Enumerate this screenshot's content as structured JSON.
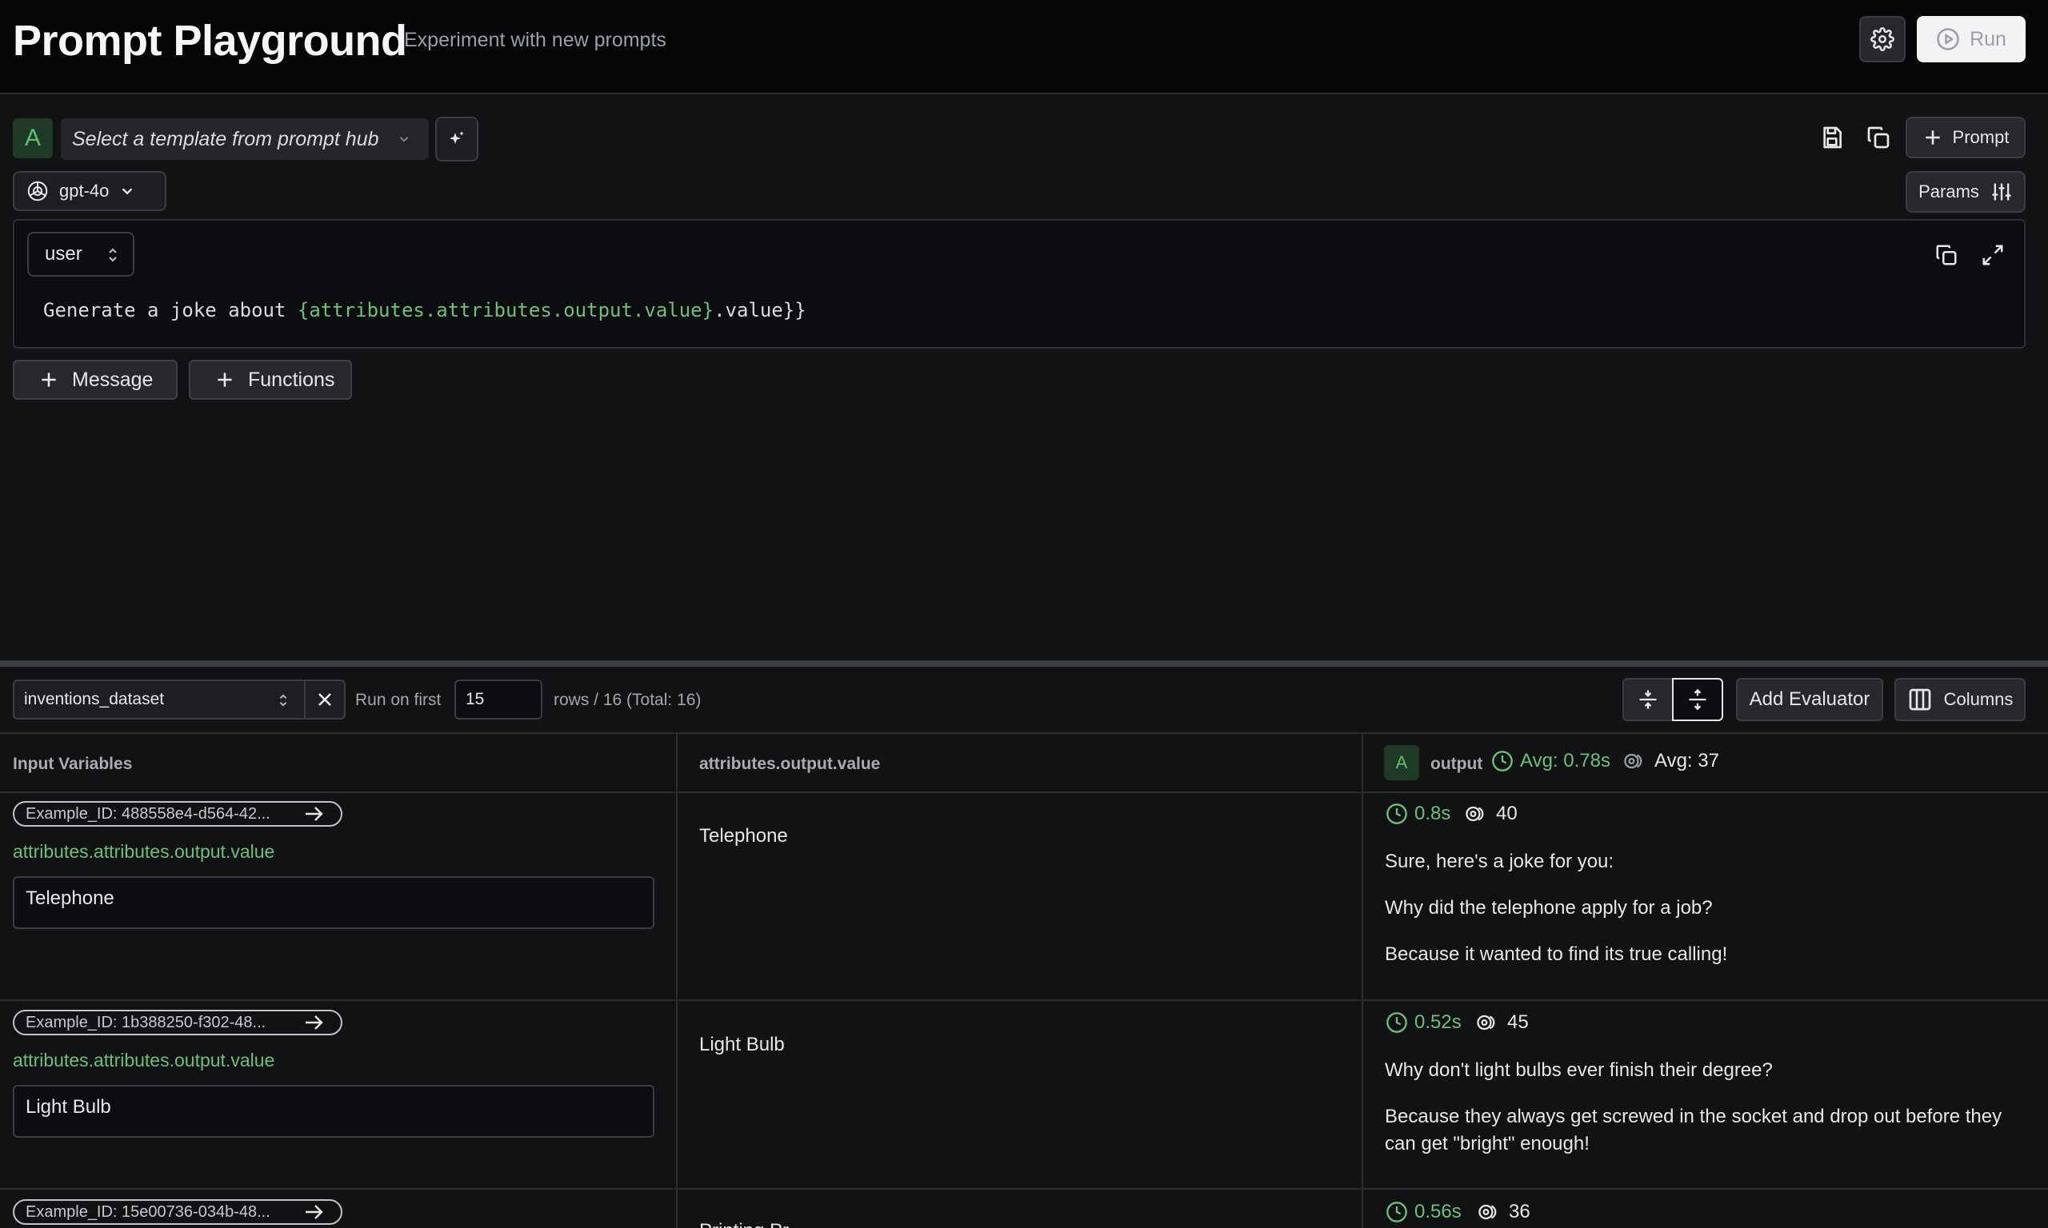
{
  "header": {
    "title": "Prompt Playground",
    "subtitle": "Experiment with new prompts",
    "run_label": "Run"
  },
  "prompt": {
    "avatar_letter": "A",
    "template_placeholder": "Select a template from prompt hub",
    "save_prompt_label": "Prompt",
    "model": "gpt-4o",
    "params_label": "Params",
    "message": {
      "role": "user",
      "text_prefix": "Generate a joke about ",
      "text_brace_open": "{",
      "text_var": "attributes.attributes.output.value",
      "text_brace_close": "}",
      "text_suffix": ".value}}"
    },
    "add_message_label": "Message",
    "add_functions_label": "Functions"
  },
  "dataset": {
    "name": "inventions_dataset",
    "run_on_first_label": "Run on first",
    "run_on_first_value": "15",
    "rows_summary": "rows / 16 (Total: 16)",
    "add_evaluator_label": "Add Evaluator",
    "columns_label": "Columns"
  },
  "table": {
    "headers": {
      "input_variables": "Input Variables",
      "reference": "attributes.output.value",
      "output_avatar": "A",
      "output": "output",
      "avg_latency": "Avg: 0.78s",
      "avg_tokens": "Avg: 37"
    },
    "rows": [
      {
        "example_id": "Example_ID: 488558e4-d564-42...",
        "var_name": "attributes.attributes.output.value",
        "var_value": "Telephone",
        "reference": "Telephone",
        "latency": "0.8s",
        "tokens": "40",
        "output_lines": [
          "Sure, here's a joke for you:",
          "Why did the telephone apply for a job?",
          "Because it wanted to find its true calling!"
        ]
      },
      {
        "example_id": "Example_ID: 1b388250-f302-48...",
        "var_name": "attributes.attributes.output.value",
        "var_value": "Light Bulb",
        "reference": "Light Bulb",
        "latency": "0.52s",
        "tokens": "45",
        "output_lines": [
          "Why don't light bulbs ever finish their degree?",
          "Because they always get screwed in the socket and drop out before they can get \"bright\" enough!"
        ]
      },
      {
        "example_id": "Example_ID: 15e00736-034b-48...",
        "reference": "Printing Pr",
        "latency": "0.56s",
        "tokens": "36"
      }
    ]
  }
}
